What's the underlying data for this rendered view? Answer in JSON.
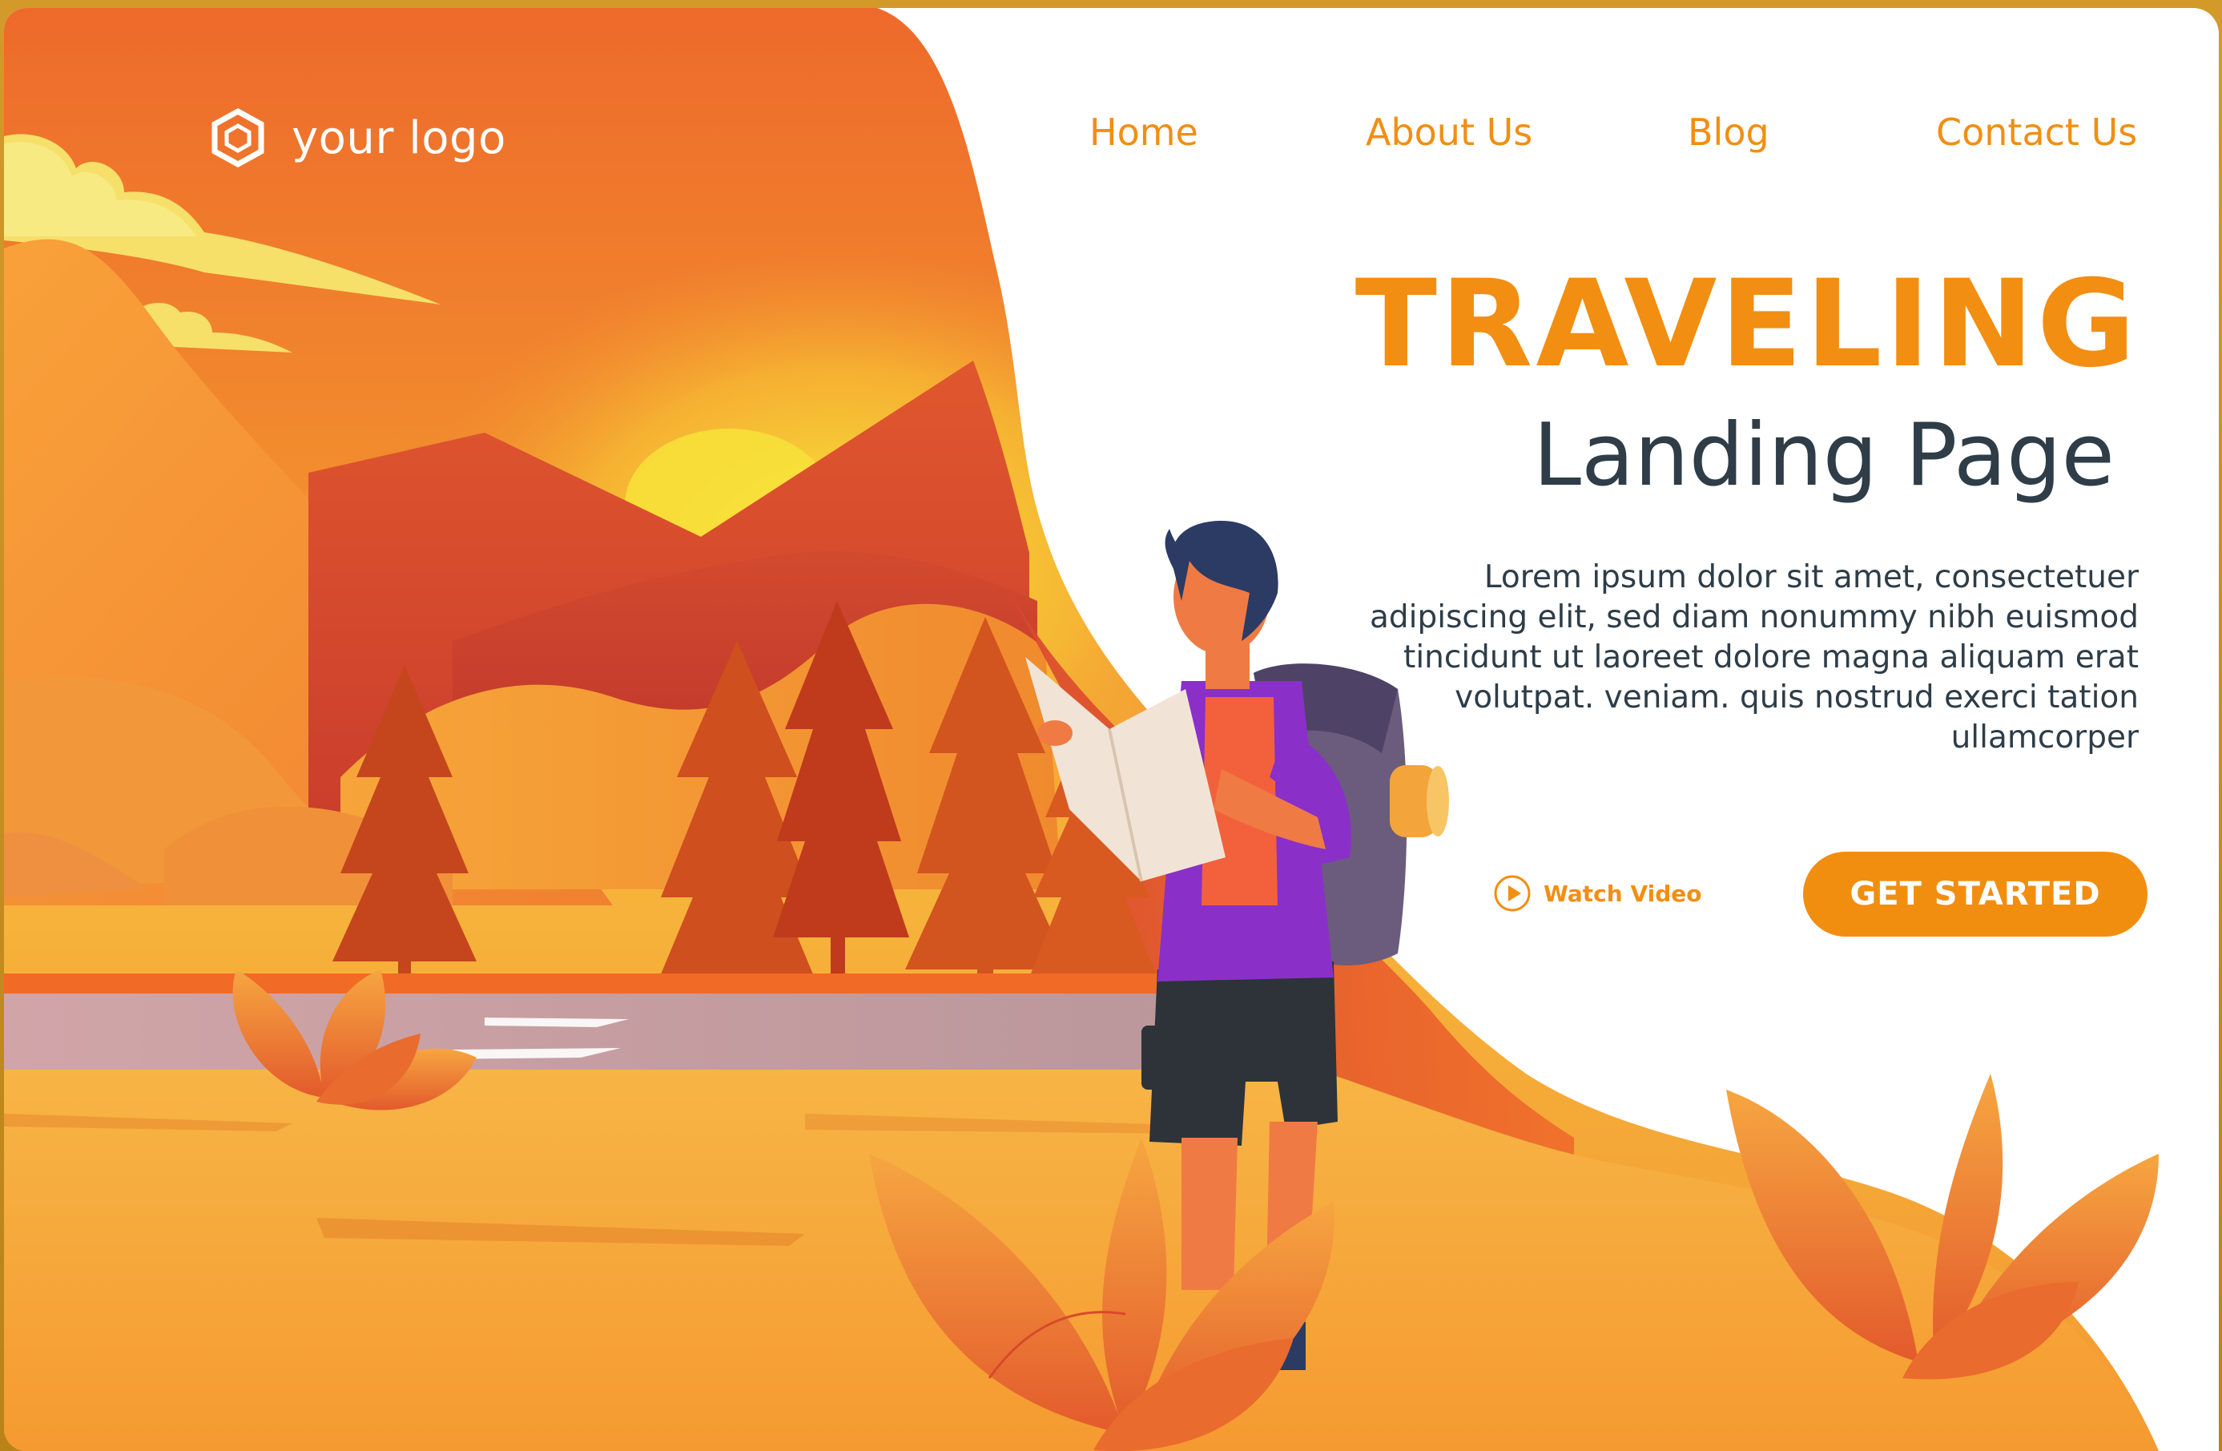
{
  "logo": {
    "text": "your logo",
    "icon": "hexagon-logo-icon"
  },
  "nav": {
    "items": [
      {
        "label": "Home"
      },
      {
        "label": "About Us"
      },
      {
        "label": "Blog"
      },
      {
        "label": "Contact Us"
      }
    ]
  },
  "hero": {
    "title": "TRAVELING",
    "subtitle": "Landing Page",
    "body": "Lorem ipsum dolor sit amet, consectetuer adipiscing elit, sed diam nonummy nibh euismod tincidunt ut laoreet dolore magna aliquam erat volutpat. veniam. quis nostrud exerci tation ullamcorper",
    "watch_video_label": "Watch Video",
    "cta_label": "GET STARTED"
  },
  "colors": {
    "accent": "#f28e12",
    "text_dark": "#2e3d48",
    "sky_orange": "#f07a2a",
    "sun_yellow": "#f7e03a",
    "mountain_red": "#d6452a",
    "tree_red": "#c5461d",
    "ground": "#f5a83b",
    "river": "#c8a7a8",
    "backpack_purple": "#8b2fc9"
  },
  "icons": {
    "play": "play-circle-icon"
  }
}
